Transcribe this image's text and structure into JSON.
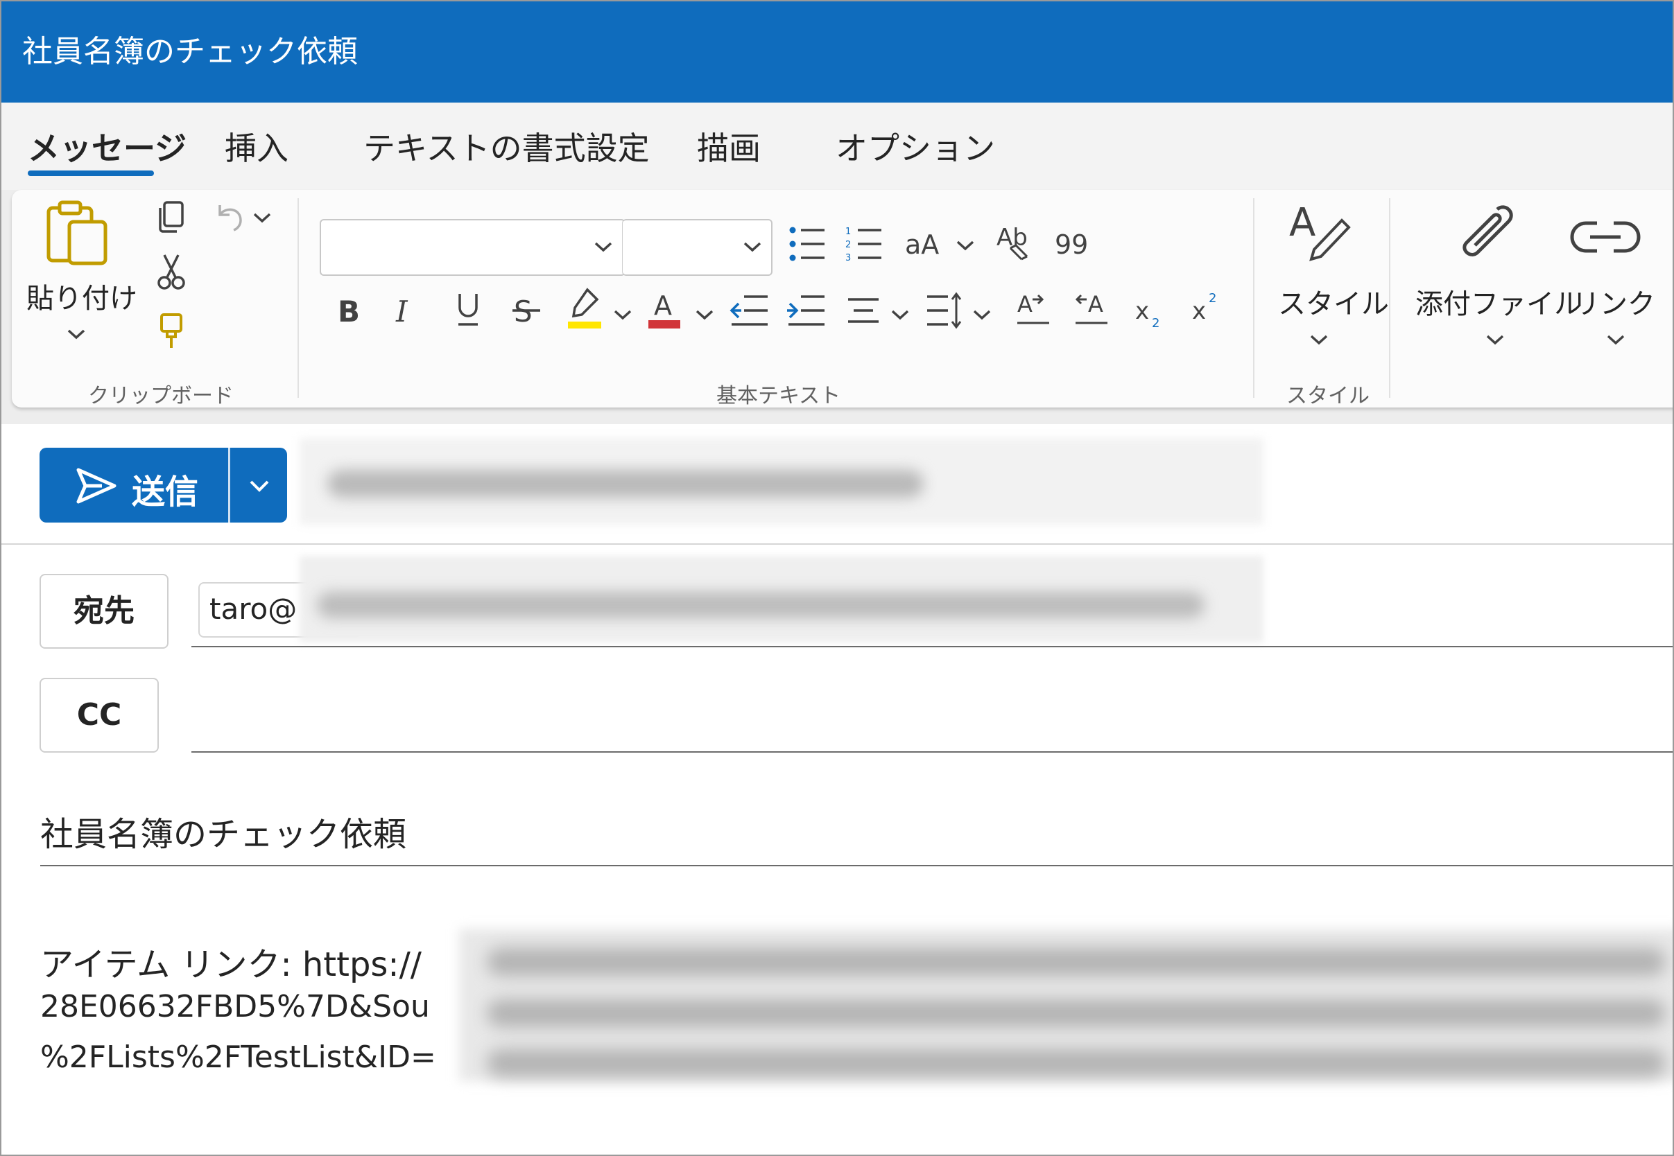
{
  "window": {
    "title": "社員名簿のチェック依頼"
  },
  "tabs": [
    {
      "label": "メッセージ",
      "active": true
    },
    {
      "label": "挿入"
    },
    {
      "label": "テキストの書式設定"
    },
    {
      "label": "描画"
    },
    {
      "label": "オプション"
    }
  ],
  "ribbon": {
    "clipboard": {
      "paste_label": "貼り付け",
      "group_label": "クリップボード"
    },
    "basic_text": {
      "font_name": "",
      "font_size": "",
      "quote_glyph": "99",
      "group_label": "基本テキスト"
    },
    "styles": {
      "label": "スタイル",
      "group_label": "スタイル"
    },
    "insert": {
      "attach_label": "添付ファイル",
      "link_label": "リンク"
    }
  },
  "compose": {
    "send_label": "送信",
    "to_button": "宛先",
    "cc_button": "CC",
    "to_chip": "taro@",
    "subject": "社員名簿のチェック依頼",
    "body_lines": [
      "アイテム リンク: https://",
      "28E06632FBD5%7D&Sou",
      "%2FLists%2FTestList&ID="
    ]
  },
  "colors": {
    "accent": "#0f6cbd",
    "highlight": "#ffe600",
    "font_color": "#d13438"
  }
}
